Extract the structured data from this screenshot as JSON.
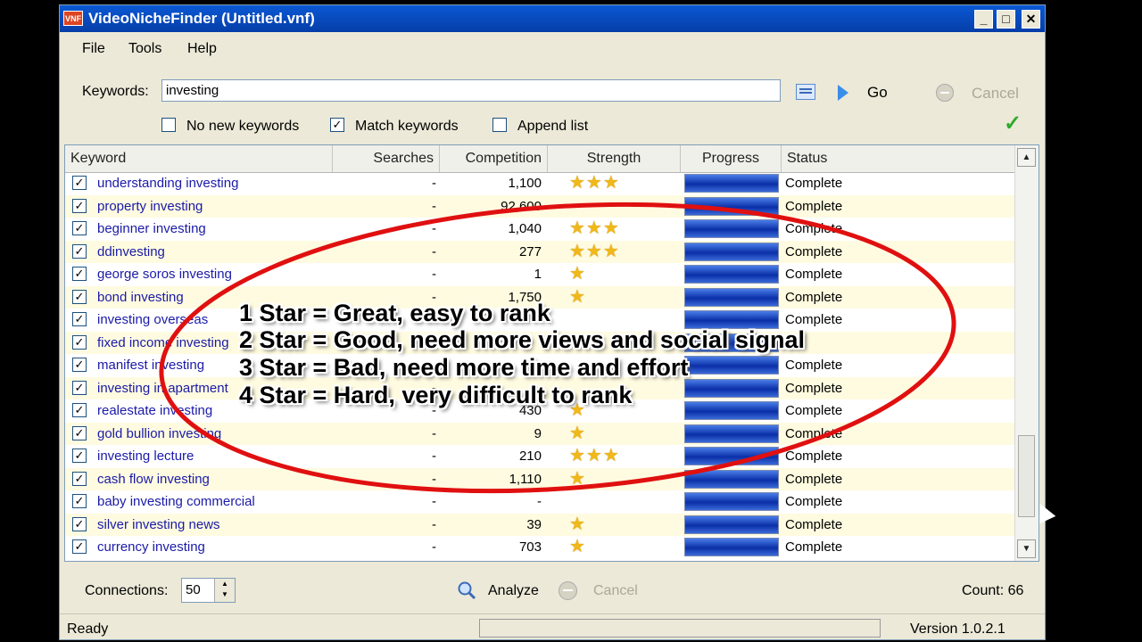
{
  "window": {
    "title": "VideoNicheFinder (Untitled.vnf)",
    "logo_text": "VNF",
    "min_label": "_",
    "max_label": "□",
    "close_label": "✕"
  },
  "menu": {
    "file": "File",
    "tools": "Tools",
    "help": "Help"
  },
  "search": {
    "label": "Keywords:",
    "value": "investing",
    "go_label": "Go",
    "cancel_label": "Cancel"
  },
  "options": {
    "no_new": {
      "label": "No new keywords",
      "checked": false
    },
    "match": {
      "label": "Match keywords",
      "checked": true
    },
    "append": {
      "label": "Append list",
      "checked": false
    }
  },
  "table": {
    "headers": [
      "Keyword",
      "Searches",
      "Competition",
      "Strength",
      "Progress",
      "Status"
    ],
    "rows": [
      {
        "keyword": "understanding investing",
        "searches": "-",
        "competition": "1,100",
        "stars": 3,
        "progress": 1.0,
        "status": "Complete"
      },
      {
        "keyword": "property investing",
        "searches": "-",
        "competition": "92,600",
        "stars": 0,
        "progress": 1.0,
        "status": "Complete"
      },
      {
        "keyword": "beginner investing",
        "searches": "-",
        "competition": "1,040",
        "stars": 3,
        "progress": 1.0,
        "status": "Complete"
      },
      {
        "keyword": "ddinvesting",
        "searches": "-",
        "competition": "277",
        "stars": 3,
        "progress": 1.0,
        "status": "Complete"
      },
      {
        "keyword": "george soros investing",
        "searches": "-",
        "competition": "1",
        "stars": 1,
        "progress": 1.0,
        "status": "Complete"
      },
      {
        "keyword": "bond investing",
        "searches": "-",
        "competition": "1,750",
        "stars": 1,
        "progress": 1.0,
        "status": "Complete"
      },
      {
        "keyword": "investing overseas",
        "searches": "-",
        "competition": "",
        "stars": 0,
        "progress": 1.0,
        "status": "Complete"
      },
      {
        "keyword": "fixed income investing",
        "searches": "-",
        "competition": "",
        "stars": 0,
        "progress": 1.0,
        "status": ""
      },
      {
        "keyword": "manifest investing",
        "searches": "-",
        "competition": "",
        "stars": 0,
        "progress": 1.0,
        "status": "Complete"
      },
      {
        "keyword": "investing in apartment",
        "searches": "-",
        "competition": "",
        "stars": 0,
        "progress": 1.0,
        "status": "Complete"
      },
      {
        "keyword": "realestate investing",
        "searches": "-",
        "competition": "430",
        "stars": 1,
        "progress": 1.0,
        "status": "Complete"
      },
      {
        "keyword": "gold bullion investing",
        "searches": "-",
        "competition": "9",
        "stars": 1,
        "progress": 1.0,
        "status": "Complete"
      },
      {
        "keyword": "investing lecture",
        "searches": "-",
        "competition": "210",
        "stars": 3,
        "progress": 1.0,
        "status": "Complete"
      },
      {
        "keyword": "cash flow investing",
        "searches": "-",
        "competition": "1,110",
        "stars": 1,
        "progress": 1.0,
        "status": "Complete"
      },
      {
        "keyword": "baby investing commercial",
        "searches": "-",
        "competition": "-",
        "stars": 0,
        "progress": 1.0,
        "status": "Complete"
      },
      {
        "keyword": "silver investing news",
        "searches": "-",
        "competition": "39",
        "stars": 1,
        "progress": 1.0,
        "status": "Complete"
      },
      {
        "keyword": "currency investing",
        "searches": "-",
        "competition": "703",
        "stars": 1,
        "progress": 1.0,
        "status": "Complete"
      }
    ]
  },
  "bottom": {
    "connections_label": "Connections:",
    "connections_value": "50",
    "analyze_label": "Analyze",
    "cancel_label": "Cancel",
    "count_label": "Count: 66"
  },
  "statusbar": {
    "status": "Ready",
    "version": "Version 1.0.2.1"
  },
  "overlay": {
    "lines": [
      "1 Star = Great, easy to rank",
      "2 Star = Good,  need more views and social signal",
      "3 Star = Bad, need more time and effort",
      "4 Star = Hard, very difficult to rank"
    ],
    "ellipse_color": "#e01010"
  }
}
